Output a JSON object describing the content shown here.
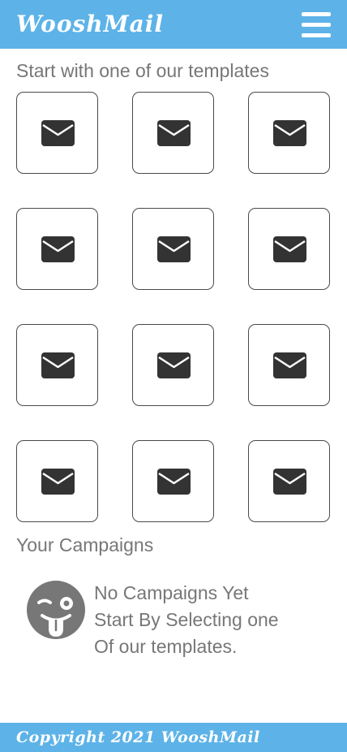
{
  "header": {
    "brand": "WooshMail",
    "menu_icon": "hamburger-menu-icon",
    "color": "#5db3e8"
  },
  "templates": {
    "title": "Start with one of our templates",
    "icon": "envelope-icon",
    "items": [
      {
        "icon": "envelope-icon"
      },
      {
        "icon": "envelope-icon"
      },
      {
        "icon": "envelope-icon"
      },
      {
        "icon": "envelope-icon"
      },
      {
        "icon": "envelope-icon"
      },
      {
        "icon": "envelope-icon"
      },
      {
        "icon": "envelope-icon"
      },
      {
        "icon": "envelope-icon"
      },
      {
        "icon": "envelope-icon"
      },
      {
        "icon": "envelope-icon"
      },
      {
        "icon": "envelope-icon"
      },
      {
        "icon": "envelope-icon"
      }
    ]
  },
  "campaigns": {
    "title": "Your Campaigns",
    "empty_icon": "wink-tongue-face-icon",
    "empty_lines": [
      "No Campaigns Yet",
      "Start By Selecting one",
      "Of our templates."
    ]
  },
  "footer": {
    "text": "Copyright 2021 WooshMail",
    "color": "#5db3e8"
  }
}
